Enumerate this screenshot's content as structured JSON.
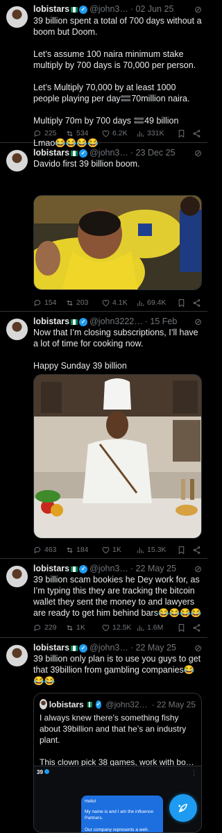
{
  "colors": {
    "background": "#000000",
    "text": "#e7e9ea",
    "muted": "#71767b",
    "accent": "#1d9bf0",
    "divider": "#2f3336"
  },
  "icons": {
    "reply": "reply-icon",
    "repost": "repost-icon",
    "like": "like-icon",
    "views": "views-icon",
    "bookmark": "bookmark-icon",
    "share": "share-icon",
    "verified": "verified-badge-icon",
    "grok": "grok-icon",
    "compose": "compose-icon"
  },
  "tweets": [
    {
      "name": "lobistars",
      "flag": "nigeria-flag",
      "handle": "@john3…",
      "date": "· 02 Jun 25",
      "lines": [
        "39 billion spent a total of 700 days without a boom but Doom.",
        "",
        "Let’s assume 100 naira minimum stake multiply by 700 days is 70,000 per person.",
        "",
        "Let’s Multiply 70,000 by at least 1000 people playing per day🟰70million naira.",
        "",
        "Multiply 70m by 700 days 🟰49 billion",
        "",
        "Lmao😂😂😂😂"
      ],
      "reply": "225",
      "repost": "534",
      "like": "6.2K",
      "views": "331K"
    },
    {
      "name": "lobistars",
      "flag": "nigeria-flag",
      "handle": "@john3…",
      "date": "· 23 Dec 25",
      "text": "Davido first 39 billion boom.",
      "reply": "154",
      "repost": "203",
      "like": "4.1K",
      "views": "69.4K"
    },
    {
      "name": "lobistars",
      "flag": "nigeria-flag",
      "handle": "@john3222…",
      "date": "· 15 Feb",
      "lines": [
        "Now that I’m closing subscriptions, I’ll have a lot of time for cooking now.",
        "",
        "Happy Sunday 39 billion"
      ],
      "reply": "463",
      "repost": "184",
      "like": "1K",
      "views": "15.3K"
    },
    {
      "name": "lobistars",
      "flag": "nigeria-flag",
      "handle": "@john3…",
      "date": "· 22 May 25",
      "text": "39 billion scam bookies he Dey work for, as I’m typing this they are tracking the bitcoin wallet they sent the money to and lawyers are ready to get him behind bars😂😂😂😂",
      "reply": "229",
      "repost": "1K",
      "like": "12.5K",
      "views": "1.6M"
    },
    {
      "name": "lobistars",
      "flag": "nigeria-flag",
      "handle": "@john3…",
      "date": "· 22 May 25",
      "text": "39 billion only plan is to use you guys to get that 39billion from gambling companies😂😂😂",
      "quote": {
        "name": "lobistars",
        "handle": "@john32…",
        "date": "· 22 May 25",
        "lines": [
          "I always knew there’s something fishy about 39billion and that he’s an industry plant.",
          "",
          "This clown pick 38 games, work with bo…"
        ],
        "screenshot_account": "39",
        "dm_greeting": "Hello!",
        "dm_body": "My name is        and I am the influence Partners.",
        "dm_footer": "Our company represents a well-known betting brand"
      }
    }
  ]
}
